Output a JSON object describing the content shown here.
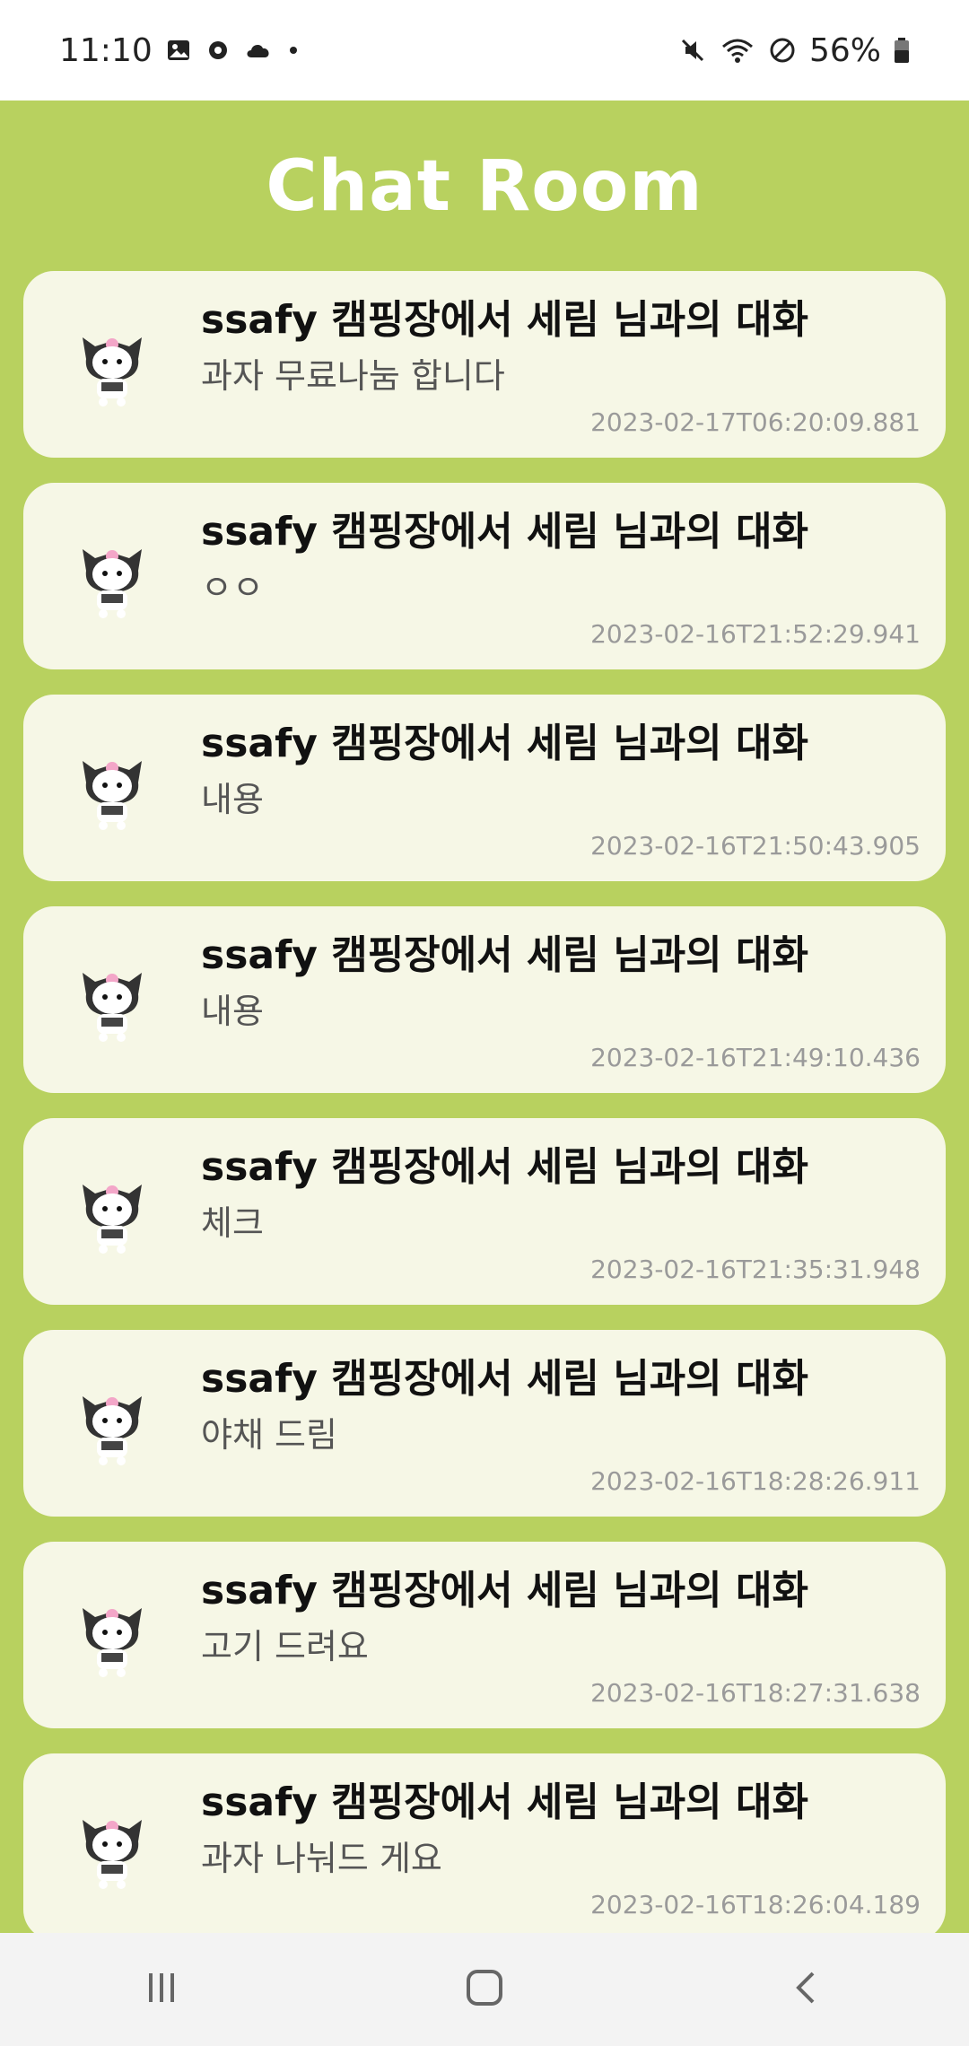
{
  "status_bar": {
    "time": "11:10",
    "battery": "56%"
  },
  "header": {
    "title": "Chat Room"
  },
  "chat_rooms": [
    {
      "title": "ssafy 캠핑장에서 세림 님과의 대화",
      "message": "과자 무료나눔 합니다",
      "time": "2023-02-17T06:20:09.881"
    },
    {
      "title": "ssafy 캠핑장에서 세림 님과의 대화",
      "message": "ㅇㅇ",
      "time": "2023-02-16T21:52:29.941"
    },
    {
      "title": "ssafy 캠핑장에서 세림 님과의 대화",
      "message": "내용",
      "time": "2023-02-16T21:50:43.905"
    },
    {
      "title": "ssafy 캠핑장에서 세림 님과의 대화",
      "message": "내용",
      "time": "2023-02-16T21:49:10.436"
    },
    {
      "title": "ssafy 캠핑장에서 세림 님과의 대화",
      "message": "체크",
      "time": "2023-02-16T21:35:31.948"
    },
    {
      "title": "ssafy 캠핑장에서 세림 님과의 대화",
      "message": "야채 드림",
      "time": "2023-02-16T18:28:26.911"
    },
    {
      "title": "ssafy 캠핑장에서 세림 님과의 대화",
      "message": "고기 드려요",
      "time": "2023-02-16T18:27:31.638"
    },
    {
      "title": "ssafy 캠핑장에서 세림 님과의 대화",
      "message": "과자 나눠드   게요",
      "time": "2023-02-16T18:26:04.189"
    }
  ],
  "colors": {
    "background": "#b8d15f",
    "card": "#f6f7e6"
  },
  "icons": {
    "status_left": [
      "gallery-icon",
      "settings-icon",
      "cloud-icon",
      "dot-icon"
    ],
    "status_right": [
      "mute-icon",
      "wifi-icon",
      "blocked-icon",
      "battery-icon"
    ],
    "nav": [
      "recent-apps-icon",
      "home-icon",
      "back-icon"
    ]
  }
}
